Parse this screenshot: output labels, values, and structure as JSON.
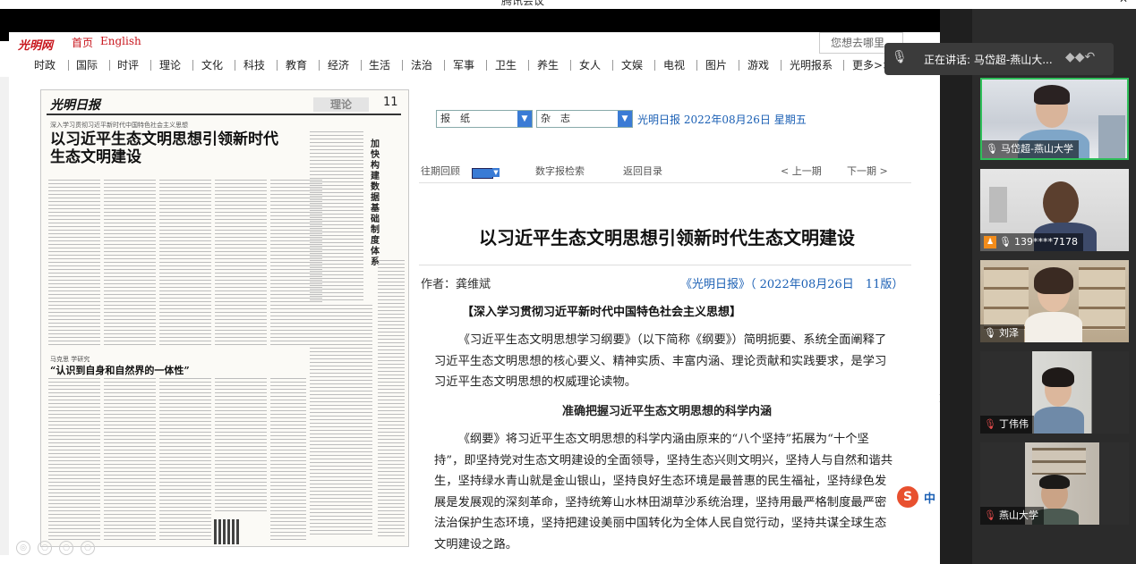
{
  "window": {
    "title": "腾讯会议",
    "minimize": "—",
    "close": "✕"
  },
  "site": {
    "logo": "光明网",
    "home": "首页",
    "english": "English",
    "search_placeholder": "您想去哪里",
    "nav": [
      "时政",
      "国际",
      "时评",
      "理论",
      "文化",
      "科技",
      "教育",
      "经济",
      "生活",
      "法治",
      "军事",
      "卫生",
      "养生",
      "女人",
      "文娱",
      "电视",
      "图片",
      "游戏",
      "光明报系",
      "更多>>"
    ]
  },
  "newspaper": {
    "name": "光明日报",
    "section": "理论",
    "page_no": "11",
    "kicker": "深入学习贯彻习近平新时代中国特色社会主义思想",
    "headline": "以习近平生态文明思想引领新时代生态文明建设",
    "side_headline": "加快构建数据基础制度体系",
    "second_kicker": "马克思 学研究",
    "second_headline": "“认识到自身和自然界的一体性”"
  },
  "epaper": {
    "select_paper": "报　纸",
    "select_magazine": "杂　志",
    "date_line": "光明日报  2022年08月26日  星期五",
    "toolbar": {
      "past": "往期回顾",
      "digital_search": "数字报检索",
      "back": "返回目录",
      "prev": "<  上一期",
      "next": "下一期  >"
    },
    "article": {
      "title": "以习近平生态文明思想引领新时代生态文明建设",
      "author": "作者：龚维斌",
      "source": "《光明日报》（ 2022年08月26日　11版）",
      "column": "【深入学习贯彻习近平新时代中国特色社会主义思想】",
      "para1": "《习近平生态文明思想学习纲要》（以下简称《纲要》）简明扼要、系统全面阐释了习近平生态文明思想的核心要义、精神实质、丰富内涵、理论贡献和实践要求，是学习习近平生态文明思想的权威理论读物。",
      "subhead": "准确把握习近平生态文明思想的科学内涵",
      "para2": "《纲要》将习近平生态文明思想的科学内涵由原来的“八个坚持”拓展为“十个坚持”，即坚持党对生态文明建设的全面领导，坚持生态兴则文明兴，坚持人与自然和谐共生，坚持绿水青山就是金山银山，坚持良好生态环境是最普惠的民生福祉，坚持绿色发展是发展观的深刻革命，坚持统筹山水林田湖草沙系统治理，坚持用最严格制度最严密法治保护生态环境，坚持把建设美丽中国转化为全体人民自觉行动，坚持共谋全球生态文明建设之路。"
    },
    "ime": "中"
  },
  "meeting": {
    "speaking_label": "正在讲话: 马岱超-燕山大...",
    "participants": [
      {
        "name": "马岱超-燕山大学",
        "muted": false,
        "active": true
      },
      {
        "name": "139****7178",
        "muted": false,
        "active": false
      },
      {
        "name": "刘泽",
        "muted": false,
        "active": false
      },
      {
        "name": "丁伟伟",
        "muted": true,
        "active": false
      },
      {
        "name": "燕山大学",
        "muted": true,
        "active": false
      }
    ]
  }
}
